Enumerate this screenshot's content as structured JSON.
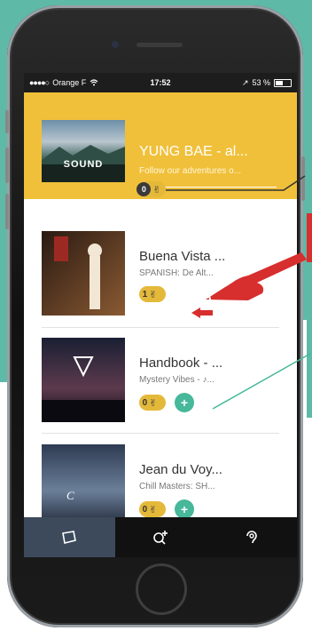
{
  "status_bar": {
    "signal": "●●●●○",
    "carrier": "Orange F",
    "wifi": "wifi",
    "time": "17:52",
    "location": "↗",
    "battery_text": "53 %",
    "battery_level": 0.53
  },
  "featured": {
    "title": "YUNG BAE - al...",
    "subtitle": "Follow our adventures o...",
    "thumb_text": "SOUND",
    "count": "0"
  },
  "items": [
    {
      "title": "Buena Vista ...",
      "subtitle": "SPANISH: De Alt...",
      "count": "1"
    },
    {
      "title": "Handbook - ...",
      "subtitle": "Mystery Vibes - ♪...",
      "count": "0"
    },
    {
      "title": "Jean du Voy...",
      "subtitle": "Chill Masters: SH...",
      "count": "0"
    }
  ],
  "tabs": [
    {
      "name": "library",
      "icon": "cube-icon",
      "active": true
    },
    {
      "name": "discover",
      "icon": "search-add-icon",
      "active": false
    },
    {
      "name": "profile",
      "icon": "ear-icon",
      "active": false
    }
  ],
  "colors": {
    "featured_bg": "#f0c03a",
    "accent_green": "#47b89a",
    "accent_red": "#d72e2e",
    "tab_active": "#3c4a5c",
    "background_teal": "#5fb9a7"
  }
}
